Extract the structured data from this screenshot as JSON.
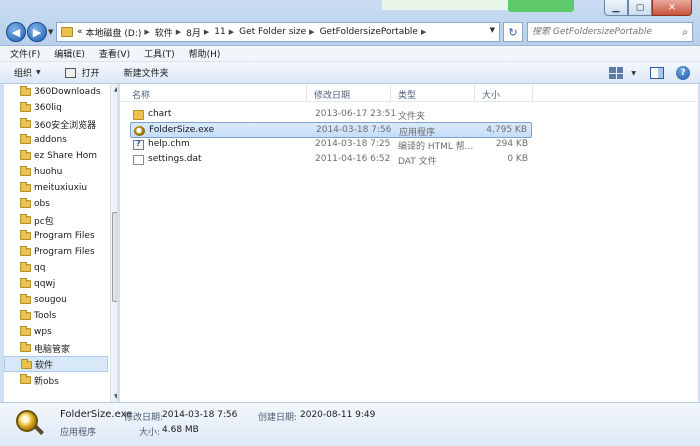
{
  "address": {
    "overflow": "«",
    "crumbs": [
      "本地磁盘 (D:)",
      "软件",
      "8月",
      "11",
      "Get Folder size",
      "GetFoldersizePortable"
    ]
  },
  "search": {
    "placeholder": "搜索 GetFoldersizePortable"
  },
  "menu": [
    "文件(F)",
    "编辑(E)",
    "查看(V)",
    "工具(T)",
    "帮助(H)"
  ],
  "toolbar": {
    "organize": "组织",
    "open": "打开",
    "new_folder": "新建文件夹"
  },
  "nav_items": [
    "360Downloads",
    "360liq",
    "360安全浏览器",
    "addons",
    "ez Share Hom",
    "huohu",
    "meituxiuxiu",
    "obs",
    "pc包",
    "Program Files",
    "Program Files",
    "qq",
    "qqwj",
    "sougou",
    "Tools",
    "wps",
    "电脑管家",
    "软件",
    "新obs"
  ],
  "nav_selected_index": 17,
  "columns": {
    "name": "名称",
    "date": "修改日期",
    "type": "类型",
    "size": "大小"
  },
  "files": [
    {
      "name": "chart",
      "date": "2013-06-17 23:51",
      "type": "文件夹",
      "size": "",
      "icon": "folder-icon"
    },
    {
      "name": "FolderSize.exe",
      "date": "2014-03-18 7:56",
      "type": "应用程序",
      "size": "4,795 KB",
      "icon": "exe-icon"
    },
    {
      "name": "help.chm",
      "date": "2014-03-18 7:25",
      "type": "编译的 HTML 帮...",
      "size": "294 KB",
      "icon": "chm-icon"
    },
    {
      "name": "settings.dat",
      "date": "2011-04-16 6:52",
      "type": "DAT 文件",
      "size": "0 KB",
      "icon": "file-icon"
    }
  ],
  "selected_file_index": 1,
  "details": {
    "name": "FolderSize.exe",
    "type": "应用程序",
    "modified_label": "修改日期:",
    "modified_value": "2014-03-18 7:56",
    "created_label": "创建日期:",
    "created_value": "2020-08-11 9:49",
    "size_label": "大小:",
    "size_value": "4.68 MB"
  }
}
